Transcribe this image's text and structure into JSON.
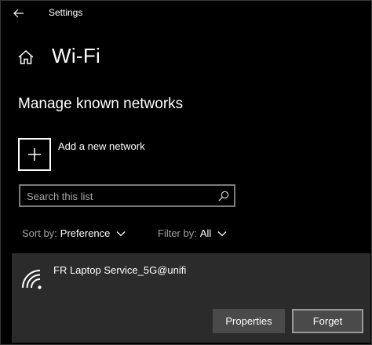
{
  "window": {
    "title": "Settings"
  },
  "page": {
    "title": "Wi-Fi"
  },
  "section": {
    "heading": "Manage known networks",
    "add_network_label": "Add a new network"
  },
  "search": {
    "placeholder": "Search this list",
    "value": ""
  },
  "sort": {
    "label": "Sort by:",
    "value": "Preference"
  },
  "filter": {
    "label": "Filter by:",
    "value": "All"
  },
  "networks": [
    {
      "name": "FR Laptop Service_5G@unifi",
      "icon": "wifi-signal-icon",
      "buttons": {
        "properties": "Properties",
        "forget": "Forget"
      }
    }
  ],
  "colors": {
    "background": "#000000",
    "panel": "#2b2b2b",
    "button": "#4a4a4a",
    "text": "#ffffff",
    "muted_text": "#a0a0a0"
  }
}
